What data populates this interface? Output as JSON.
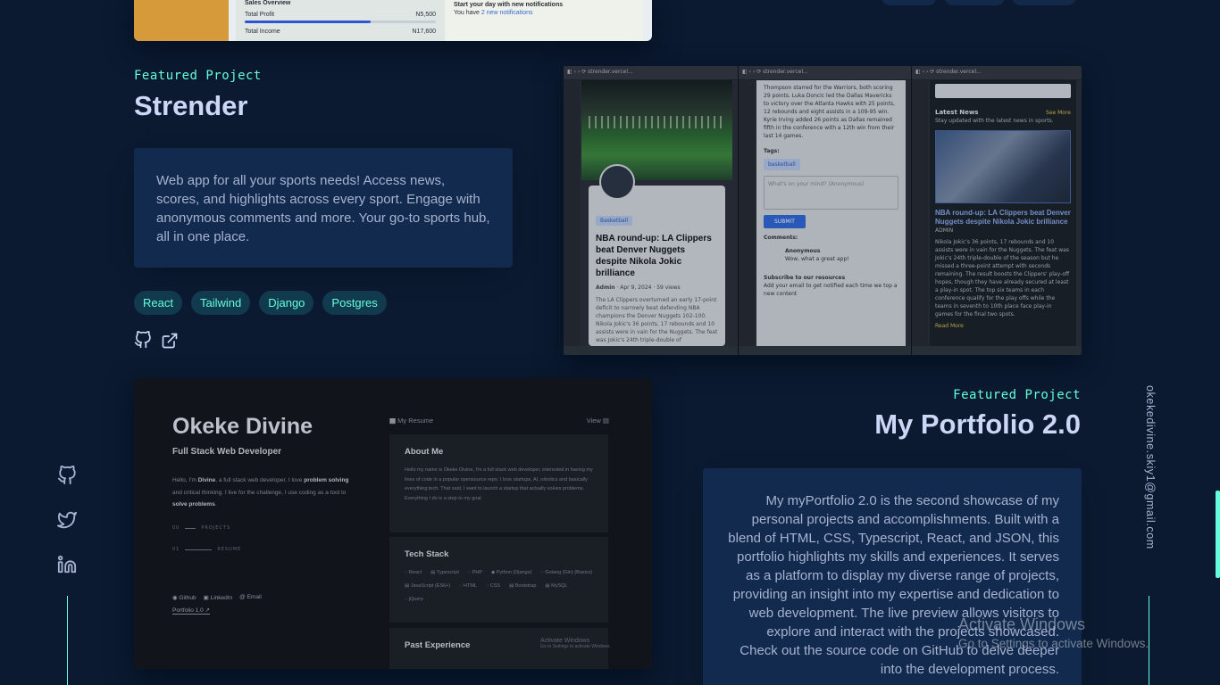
{
  "top_project_preview": {
    "sales_title": "Sales Overview",
    "total_profit_label": "Total Profit",
    "total_profit_value": "N5,500",
    "total_profit_progress": 0.66,
    "total_income_label": "Total Income",
    "total_income_value": "N17,600",
    "notif_title": "Start your day with new notifications",
    "notif_prefix": "You have",
    "notif_link": "2 new notifications"
  },
  "project1": {
    "overline": "Featured Project",
    "title": "Strender",
    "description": "Web app for all your sports needs! Access news, scores, and highlights across every sport. Engage with anonymous comments and more. Your go-to sports hub, all in one place.",
    "tech": [
      "React",
      "Tailwind",
      "Django",
      "Postgres"
    ],
    "github_icon": "github-icon",
    "external_icon": "external-link-icon",
    "preview": {
      "url": "strender.vercel...",
      "chip": "Basketball",
      "headline": "NBA round-up: LA Clippers beat Denver Nuggets despite Nikola Jokic brilliance",
      "meta_author": "Admin",
      "meta_date": "Apr 9, 2024",
      "meta_views": "59 views",
      "excerpt": "The LA Clippers overturned an early 17-point deficit to narrowly beat defending NBA champions the Denver Nuggets 102-100. Nikola Jokic's 36 points, 17 rebounds and 10 assists were in vain for the Nuggets. The feat was Jokic's 24th triple-double of",
      "mid_text": "Thompson starred for the Warriors, both scoring 29 points. Luka Doncic led the Dallas Mavericks to victory over the Atlanta Hawks with 25 points, 12 rebounds and eight assists in a 109-95 win. Kyrie Irving added 26 points as Dallas remained fifth in the conference with a 12th win from their last 14 games.",
      "tags_label": "Tags:",
      "tag": "basketball",
      "comment_placeholder": "What's on your mind? (Anonymous)",
      "submit": "SUBMIT",
      "comments_label": "Comments:",
      "comment_author": "Anonymous",
      "comment_text": "Wow, what a great app!",
      "subscribe_title": "Subscribe to our resources",
      "subscribe_text": "Add your email to get notified each time we top a new content",
      "latest_news": "Latest News",
      "see_more": "See More",
      "latest_sub": "Stay updated with the latest news in sports.",
      "admin": "ADMIN",
      "right_excerpt": "Nikola Jokic's 36 points, 17 rebounds and 10 assists were in vain for the Nuggets. The feat was Jokic's 24th triple-double of the season but he missed a three-point attempt with seconds remaining. The result boosts the Clippers' play-off hopes, though they have already secured at least a play-in spot. The top six teams in each conference qualify for the play offs while the teams in seventh to 10th place face play-in games for the final two spots.",
      "read_more": "Read More"
    }
  },
  "project2": {
    "overline": "Featured Project",
    "title": "My Portfolio 2.0",
    "description": "My myPortfolio 2.0 is the second showcase of my personal projects and accomplishments. Built with a blend of HTML, CSS, Typescript, React, and JSON, this portfolio highlights my skills and experiences. It serves as a platform to display my diverse range of projects, providing an insight into my expertise and dedication to web development. The live preview allows visitors to explore and interact with the projects showcased. Check out the source code on GitHub to delve deeper into the development process.",
    "preview": {
      "name": "Okeke Divine",
      "role": "Full Stack Web Developer",
      "intro_1": "Hello, I'm ",
      "intro_name": "Divine",
      "intro_2": ", a full stack web developer. I love ",
      "intro_ps": "problem solving",
      "intro_3": " and critical thinking. I live for the challenge, I use coding as a tool to ",
      "intro_sp": "solve problems",
      "intro_4": ".",
      "nav_projects_num": "00",
      "nav_projects": "PROJECTS",
      "nav_resume_num": "01",
      "nav_resume": "RESUME",
      "footer_github": "Github",
      "footer_linkedin": "LinkedIn",
      "footer_email": "Email",
      "version_link": "Portfolio 1.0 ↗",
      "resume_header": "My Resume",
      "view_label": "View",
      "about_title": "About Me",
      "about_text": "Hello my name is Okeke Divine, I'm a full stack web developer, interested in having my lines of code in a popular opensource repo. I love startups, AI, robotics and basically everything tech. That said, I want to launch a startup that actually solves problems. Everything I do is a step to my goal",
      "stack_title": "Tech Stack",
      "stack": [
        "React",
        "Typescript",
        "PHP",
        "Python (Django)",
        "Golang (Gin) (Basics)",
        "JavaScript (ES6+)",
        "HTML",
        "CSS",
        "Bootstrap",
        "MySQL",
        "jQuery"
      ],
      "past_title": "Past Experience",
      "wm_1": "Activate Windows",
      "wm_2": "Go to Settings to activate Windows."
    }
  },
  "social": {
    "github": "github-icon",
    "twitter": "twitter-icon",
    "linkedin": "linkedin-icon"
  },
  "email": "okekedivine.skiy1@gmail.com",
  "watermark": {
    "title": "Activate Windows",
    "subtitle": "Go to Settings to activate Windows."
  },
  "colors": {
    "background": "#0b1a30",
    "accent": "#64ffda",
    "card": "#112a4e",
    "text": "#ccd6f6"
  }
}
